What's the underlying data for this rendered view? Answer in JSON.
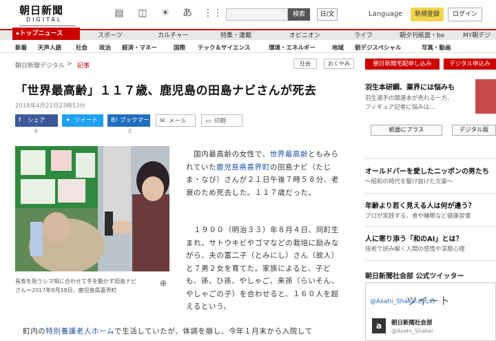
{
  "header": {
    "logo_main": "朝日新聞",
    "logo_sub": "DIGITAL",
    "search_button": "検索",
    "lang_toggle": "日/文",
    "language": "Language",
    "register": "新規登録",
    "login": "ログイン"
  },
  "nav": {
    "top_news": "▸トップニュース",
    "items": [
      "スポーツ",
      "カルチャー",
      "特集・連載",
      "オピニオン",
      "ライフ",
      "朝夕刊紙面・be",
      "MY朝デジ"
    ],
    "sub_items": [
      "新着",
      "天声人語",
      "社会",
      "政治",
      "経済・マネー",
      "国際",
      "テック＆サイエンス",
      "環境・エネルギー",
      "地域",
      "朝デジスペシャル",
      "写真・動画"
    ]
  },
  "breadcrumb": {
    "home": "朝日新聞デジタル",
    "sep": ">",
    "current": "記事",
    "tag1": "社会",
    "tag2": "おくやみ"
  },
  "promo": {
    "delivery": "朝日新聞宅配申し込み",
    "digital": "デジタル申込み"
  },
  "article": {
    "headline": "「世界最高齢」１１７歳、鹿児島の田島ナビさんが死去",
    "date": "2018年4月21日23時53分",
    "share": {
      "facebook": "シェア",
      "twitter": "ツイート",
      "bookmark": "ブックマーク",
      "mail": "メール",
      "print": "印刷",
      "fb_count": "6",
      "tw_count": "",
      "bm_count": "0"
    },
    "caption_line1": "長寿を祝うシマ唄に合わせて手を動かす田島ナビ",
    "caption_line2": "さん＝2017年8月18日、鹿児島県喜界町",
    "para1_a": "　国内最高齢の女性で、",
    "para1_link1": "世界最高齢",
    "para1_b": "ともみられていた",
    "para1_link2": "鹿児島県",
    "para1_link3": "喜界町",
    "para1_c": "の田島ナビ（たじま・なび）さんが２１日午後７時５８分、老衰のため死去した。１１７歳だった。",
    "para2": "　１９００（明治３３）年８月４日、同町生まれ。サトウキビやゴマなどの栽培に励みながら、夫の富二子（とみにし）さん（故人）と７男２女を育てた。家族によると、子ども、孫、ひ孫、やしゃご、来孫（らいそん、やしゃごの子）を合わせると、１６０人を超えるという。",
    "para3_a": "　町内の",
    "para3_link": "特別養護老人ホーム",
    "para3_b": "で生活していたが、体調を崩し、今年１月末から入院して"
  },
  "sidebar": {
    "ad_title": "羽生本研鋼、業界には悩みも",
    "ad_sub1": "羽生選手の関連本が売れる一方、",
    "ad_sub2": "フィギュア記者に悩みは…",
    "btn_plus": "紙面にプラス",
    "btn_digital": "デジタル版",
    "item1_title": "オールドバーを愛したニッポンの男たち",
    "item1_sub": "〜昭和の時代を駆け抜けた文豪〜",
    "item2_title": "年齢より若く見える人は何が違う？",
    "item2_sub": "プロが実践する、食や睡眠など健康習慣",
    "item3_title": "人に寄り添う「和のAI」とは？",
    "item3_sub": "技術で読み解く人間の感情や深層心理",
    "twitter_section": "朝日新聞社会部 公式ツイッター",
    "tw_handle": "@Asahi_Shakaiさんの",
    "tw_tweet": "ツイート",
    "tw_name": "朝日新聞社会部",
    "tw_user": "@Asahi_Shakai"
  }
}
